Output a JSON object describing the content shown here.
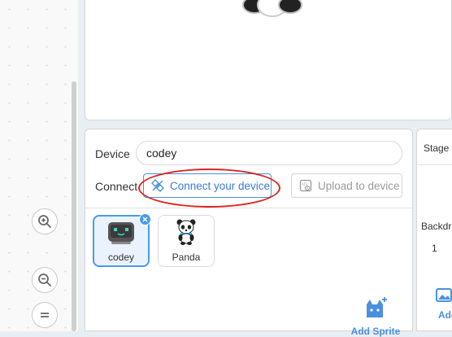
{
  "sprite_panel": {
    "device_label": "Device",
    "device_value": "codey",
    "connect_label": "Connect",
    "connect_button": "Connect your device",
    "upload_button": "Upload to device",
    "sprites": [
      {
        "name": "codey"
      },
      {
        "name": "Panda"
      }
    ],
    "add_sprite_label": "Add Sprite"
  },
  "stage_panel": {
    "title": "Stage",
    "backdrops_label": "Backdrops",
    "backdrop_count": "1",
    "add_backdrop_label": "Add Backdrop"
  },
  "colors": {
    "accent": "#4a90e2",
    "highlight": "#e0231d"
  }
}
